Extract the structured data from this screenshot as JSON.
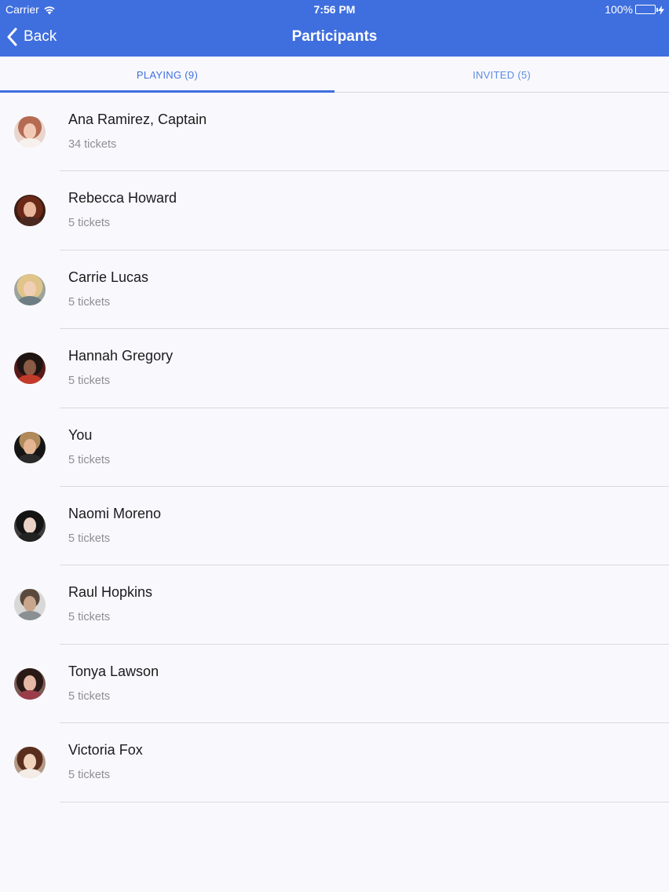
{
  "status_bar": {
    "carrier": "Carrier",
    "time": "7:56 PM",
    "battery": "100%"
  },
  "nav": {
    "back_label": "Back",
    "title": "Participants"
  },
  "tabs": [
    {
      "label": "PLAYING (9)",
      "active": true
    },
    {
      "label": "INVITED (5)",
      "active": false
    }
  ],
  "colors": {
    "accent": "#3f6ede",
    "background": "#f9f9fd",
    "secondary_text": "#8e8e93"
  },
  "participants": [
    {
      "name": "Ana Ramirez, Captain",
      "tickets": "34 tickets"
    },
    {
      "name": "Rebecca Howard",
      "tickets": "5 tickets"
    },
    {
      "name": "Carrie Lucas",
      "tickets": "5 tickets"
    },
    {
      "name": "Hannah Gregory",
      "tickets": "5 tickets"
    },
    {
      "name": "You",
      "tickets": "5 tickets"
    },
    {
      "name": "Naomi Moreno",
      "tickets": "5 tickets"
    },
    {
      "name": "Raul Hopkins",
      "tickets": "5 tickets"
    },
    {
      "name": "Tonya Lawson",
      "tickets": "5 tickets"
    },
    {
      "name": "Victoria Fox",
      "tickets": "5 tickets"
    }
  ]
}
